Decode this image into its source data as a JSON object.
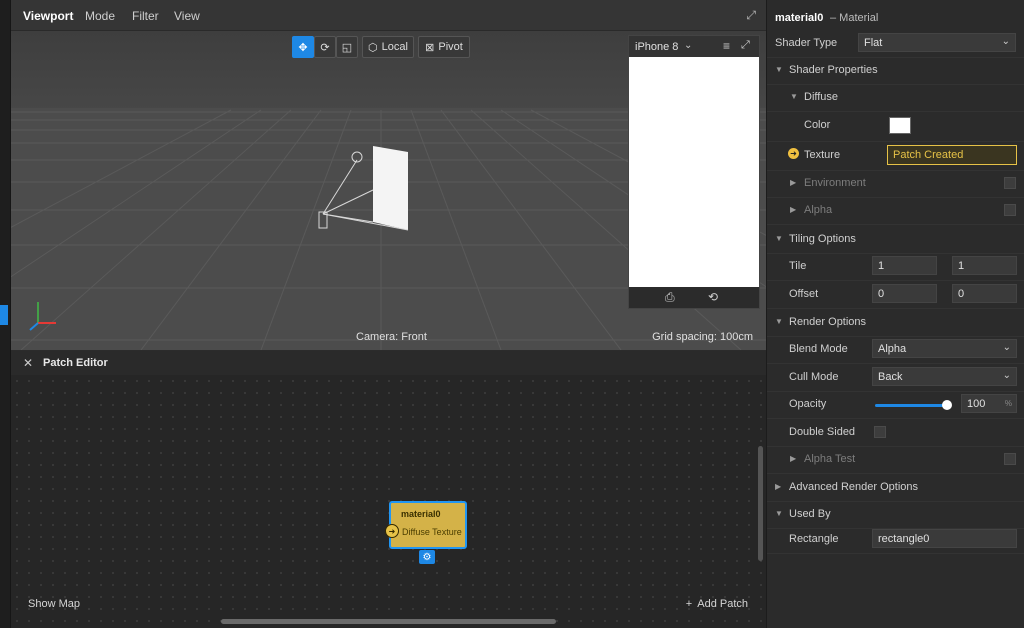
{
  "viewport": {
    "menu": {
      "title": "Viewport",
      "mode": "Mode",
      "filter": "Filter",
      "view": "View"
    },
    "toolbar": {
      "local": "Local",
      "pivot": "Pivot"
    },
    "camera_label": "Camera: Front",
    "grid_label": "Grid spacing: 100cm",
    "preview": {
      "device": "iPhone 8"
    }
  },
  "patch_editor": {
    "title": "Patch Editor",
    "node": {
      "title": "material0",
      "port": "Diffuse Texture"
    },
    "show_map": "Show Map",
    "add_patch": "Add Patch"
  },
  "inspector": {
    "name": "material0",
    "type": "– Material",
    "shader_type": {
      "label": "Shader Type",
      "value": "Flat"
    },
    "shader_properties": "Shader Properties",
    "diffuse": "Diffuse",
    "color_label": "Color",
    "color_value": "#ffffff",
    "texture": {
      "label": "Texture",
      "value": "Patch Created"
    },
    "environment": "Environment",
    "alpha": "Alpha",
    "tiling_options": "Tiling Options",
    "tile": {
      "label": "Tile",
      "x": "1",
      "y": "1"
    },
    "offset": {
      "label": "Offset",
      "x": "0",
      "y": "0"
    },
    "render_options": "Render Options",
    "blend_mode": {
      "label": "Blend Mode",
      "value": "Alpha"
    },
    "cull_mode": {
      "label": "Cull Mode",
      "value": "Back"
    },
    "opacity": {
      "label": "Opacity",
      "value": "100",
      "unit": "%",
      "fraction": 1.0
    },
    "double_sided": "Double Sided",
    "alpha_test": "Alpha Test",
    "advanced": "Advanced Render Options",
    "used_by": "Used By",
    "rectangle": {
      "label": "Rectangle",
      "value": "rectangle0"
    }
  },
  "colors": {
    "accent": "#1e88e5",
    "patch": "#d4b248"
  }
}
